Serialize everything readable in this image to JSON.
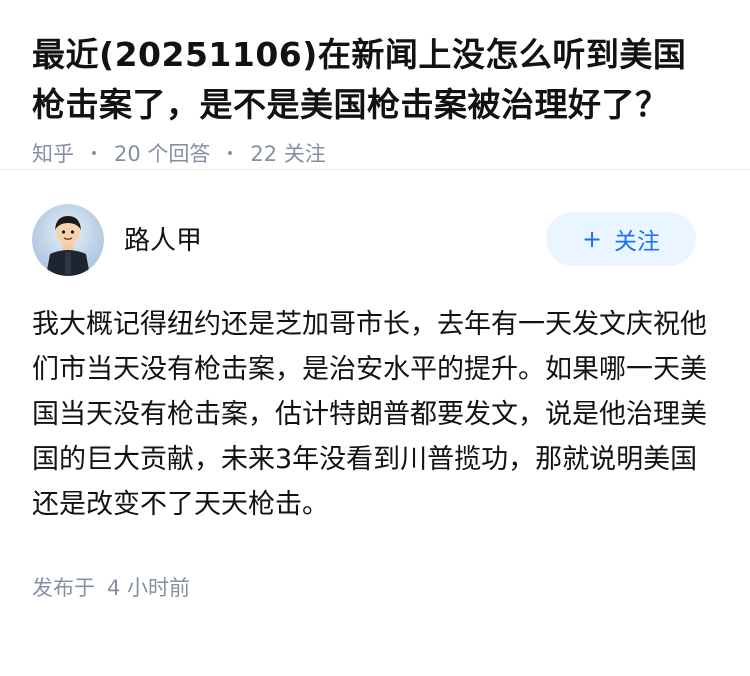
{
  "question": {
    "title": "最近(20251106)在新闻上没怎么听到美国枪击案了，是不是美国枪击案被治理好了？",
    "source": "知乎",
    "answer_count": "20 个回答",
    "follower_count": "22 关注"
  },
  "answer": {
    "author": {
      "name": "路人甲",
      "avatar_icon": "avatar-cartoon-student"
    },
    "follow_button": {
      "icon": "plus-icon",
      "icon_glyph": "+",
      "label": "关注"
    },
    "content": "我大概记得纽约还是芝加哥市长，去年有一天发文庆祝他们市当天没有枪击案，是治安水平的提升。如果哪一天美国当天没有枪击案，估计特朗普都要发文，说是他治理美国的巨大贡献，未来3年没看到川普揽功，那就说明美国还是改变不了天天枪击。",
    "published_prefix": "发布于",
    "published_time": "4 小时前"
  },
  "colors": {
    "accent": "#1772f6",
    "follow_bg": "#ebf5ff",
    "meta_gray": "#8590a6"
  }
}
